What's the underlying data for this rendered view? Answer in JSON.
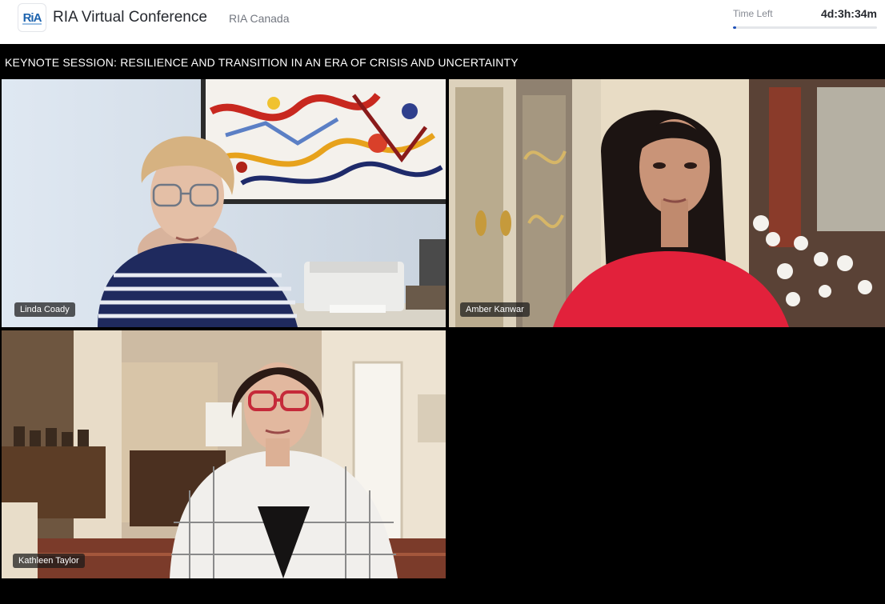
{
  "header": {
    "logo_text": "RiA",
    "app_title": "RIA Virtual Conference",
    "org_name": "RIA Canada",
    "timer_label": "Time Left",
    "timer_value": "4d:3h:34m",
    "timer_progress": 0.02
  },
  "session": {
    "title": "KEYNOTE SESSION: RESILIENCE AND TRANSITION IN AN ERA OF CRISIS AND UNCERTAINTY"
  },
  "participants": [
    {
      "name": "Linda Coady"
    },
    {
      "name": "Amber Kanwar"
    },
    {
      "name": "Kathleen Taylor"
    }
  ],
  "colors": {
    "accent": "#1d4fb8",
    "brand_blue": "#1b62ad",
    "stage_background": "#000000"
  }
}
